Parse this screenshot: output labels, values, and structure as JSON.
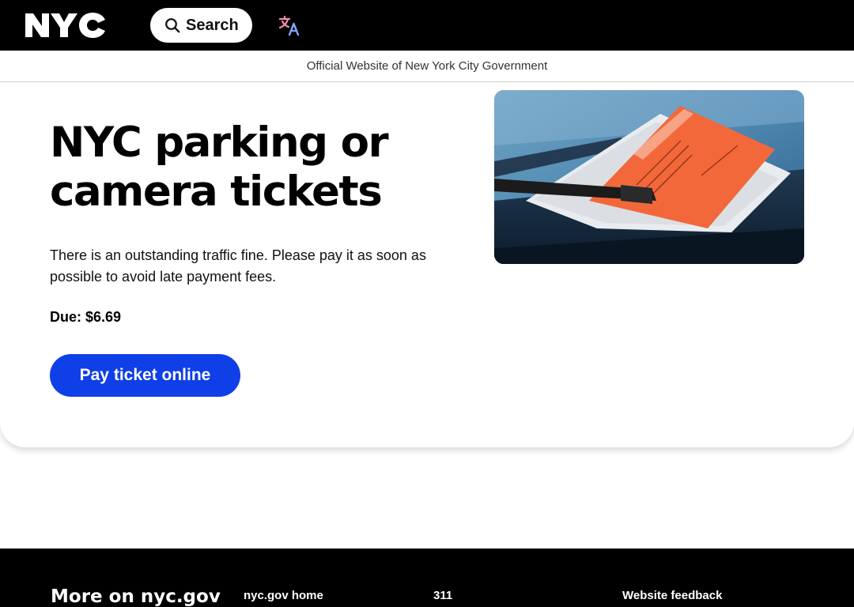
{
  "header": {
    "logo_text": "NYC",
    "search_label": "Search",
    "translate_icon": "translate-icon"
  },
  "banner": {
    "official_text": "Official Website of New York City Government"
  },
  "hero": {
    "title": "NYC parking or camera tickets",
    "description": "There is an outstanding traffic fine. Please pay it as soon as possible to avoid late payment fees.",
    "due_label": "Due:",
    "due_amount": "$6.69",
    "pay_button_label": "Pay ticket online"
  },
  "footer": {
    "title": "More on nyc.gov",
    "links": [
      "nyc.gov home",
      "311",
      "Website feedback"
    ]
  },
  "colors": {
    "accent": "#0f3fe6",
    "topbar": "#000000",
    "ticket_orange": "#f2683a"
  }
}
